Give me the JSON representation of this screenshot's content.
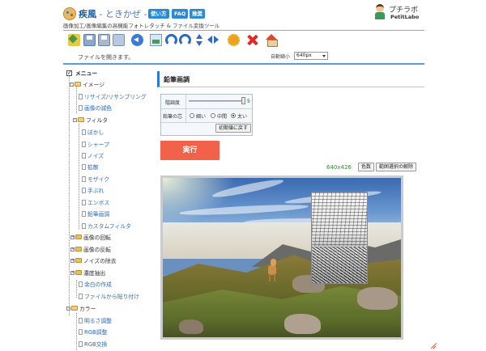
{
  "header": {
    "title": "疾風",
    "title_sub": " - ときかぜ -",
    "subtitle": "画像加工/画像編集の高機能フォトレタッチ & ファイル変換ツール",
    "nav": [
      "使い方",
      "FAQ",
      "推奨"
    ],
    "brand_name": "プチラボ",
    "brand_sub": "PetitLabo"
  },
  "toolbar": {
    "icons": [
      "open-icon",
      "save-icon",
      "save-as-icon",
      "copy-icon",
      "back-icon",
      "image-icon",
      "rotate-left-icon",
      "rotate-right-icon",
      "flip-vertical-icon",
      "flip-horizontal-icon",
      "settings-icon",
      "close-icon",
      "home-icon"
    ],
    "status": "ファイルを開きます。",
    "autoshrink_label": "自動縮小",
    "autoshrink_value": "640px"
  },
  "sidebar": {
    "root": "メニュー",
    "items": [
      {
        "label": "イメージ"
      },
      {
        "label": "リサイズ/リサンプリング"
      },
      {
        "label": "画像の減色"
      },
      {
        "label": "フィルタ"
      },
      {
        "label": "ぼかし"
      },
      {
        "label": "シャープ"
      },
      {
        "label": "ノイズ"
      },
      {
        "label": "拡散"
      },
      {
        "label": "モザイク"
      },
      {
        "label": "手ぶれ"
      },
      {
        "label": "エンボス"
      },
      {
        "label": "鉛筆画調"
      },
      {
        "label": "カスタムフィルタ"
      },
      {
        "label": "画像の回転"
      },
      {
        "label": "画像の反転"
      },
      {
        "label": "ノイズの除去"
      },
      {
        "label": "濃度抽出"
      },
      {
        "label": "余白の作成"
      },
      {
        "label": "ファイルから貼り付け"
      },
      {
        "label": "カラー"
      },
      {
        "label": "明るさ調整"
      },
      {
        "label": "RGB調整"
      },
      {
        "label": "RGB交換"
      }
    ]
  },
  "panel": {
    "title": "鉛筆画調",
    "gradation_label": "階調度",
    "gradation_value": "5",
    "gradation_level": 1.0,
    "core_label": "鉛筆の芯",
    "options": [
      "細い",
      "中間",
      "太い"
    ],
    "selected_option": "太い",
    "reset_label": "初期値に戻す",
    "run_label": "実行",
    "image_size": "640x426",
    "color_count_label": "色数",
    "clear_selection_label": "範囲選択の解除"
  },
  "colors": {
    "accent": "#2a7ad8",
    "run_button": "#f2624a",
    "link": "#2a6ac8",
    "size_text": "#3a8a3a"
  }
}
